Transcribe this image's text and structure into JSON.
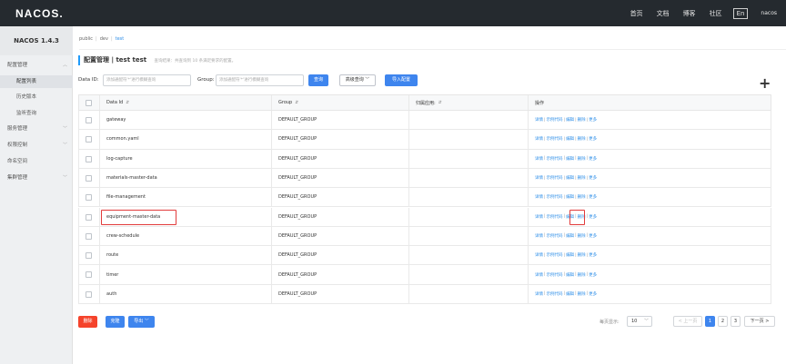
{
  "topbar": {
    "logo": "NACOS.",
    "nav": [
      "首页",
      "文档",
      "博客",
      "社区"
    ],
    "lang": "En",
    "user": "nacos"
  },
  "sidebar": {
    "version": "NACOS 1.4.3",
    "items": [
      {
        "label": "配置管理",
        "type": "group",
        "expanded": true
      },
      {
        "label": "配置列表",
        "type": "sub",
        "active": true
      },
      {
        "label": "历史版本",
        "type": "sub"
      },
      {
        "label": "监听查询",
        "type": "sub"
      },
      {
        "label": "服务管理",
        "type": "group"
      },
      {
        "label": "权限控制",
        "type": "group"
      },
      {
        "label": "命名空间",
        "type": "item"
      },
      {
        "label": "集群管理",
        "type": "group"
      }
    ]
  },
  "namespaces": {
    "items": [
      "public",
      "dev",
      "test"
    ],
    "current": "test"
  },
  "title": {
    "label": "配置管理",
    "sep": "|",
    "namespace": "test",
    "ns_id": "test",
    "hint": "查询结果：共查询到 10 条满足要求的配置。"
  },
  "search": {
    "dataid_label": "Data ID:",
    "dataid_placeholder": "添加通配符'*'进行模糊查询",
    "group_label": "Group:",
    "group_placeholder": "添加通配符'*'进行模糊查询",
    "query_btn": "查询",
    "advanced_btn": "高级查询",
    "import_btn": "导入配置",
    "add_icon": "+"
  },
  "table": {
    "headers": {
      "dataid": "Data Id",
      "group": "Group",
      "app": "归属应用:",
      "ops": "操作"
    },
    "rows": [
      {
        "dataid": "gateway",
        "group": "DEFAULT_GROUP"
      },
      {
        "dataid": "common.yaml",
        "group": "DEFAULT_GROUP"
      },
      {
        "dataid": "log-capture",
        "group": "DEFAULT_GROUP"
      },
      {
        "dataid": "materials-master-data",
        "group": "DEFAULT_GROUP"
      },
      {
        "dataid": "file-management",
        "group": "DEFAULT_GROUP"
      },
      {
        "dataid": "equipment-master-data",
        "group": "DEFAULT_GROUP"
      },
      {
        "dataid": "crew-schedule",
        "group": "DEFAULT_GROUP"
      },
      {
        "dataid": "route",
        "group": "DEFAULT_GROUP"
      },
      {
        "dataid": "timer",
        "group": "DEFAULT_GROUP"
      },
      {
        "dataid": "auth",
        "group": "DEFAULT_GROUP"
      }
    ],
    "ops": {
      "detail": "详情",
      "sample": "示例代码",
      "edit": "编辑",
      "delete": "删除",
      "more": "更多",
      "bar": "|"
    },
    "highlight_row": 5
  },
  "footer": {
    "delete_btn": "删除",
    "clone_btn": "克隆",
    "export_btn": "导出",
    "page_size_label": "每页显示:",
    "page_size": "10",
    "prev": "< 上一页",
    "pages": [
      "1",
      "2",
      "3"
    ],
    "current_page": "1",
    "next": "下一页 >"
  },
  "colors": {
    "accent": "#3e85ee",
    "danger": "#f5432b",
    "highlight": "#e23b3b",
    "topbar": "#252a2f"
  }
}
